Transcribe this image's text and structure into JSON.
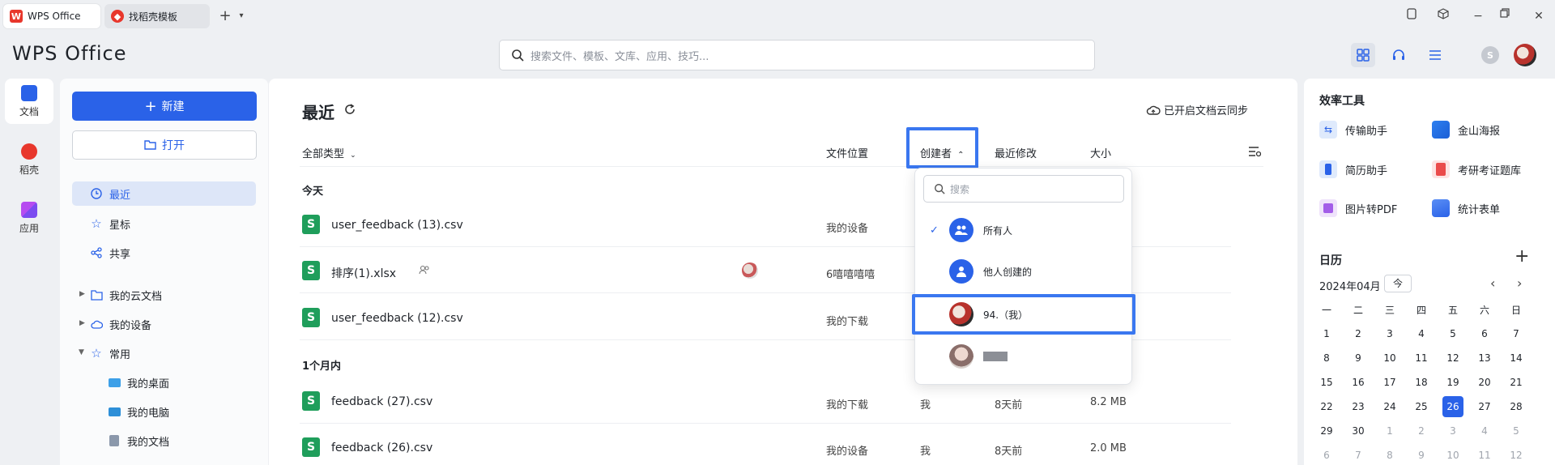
{
  "tabs": [
    {
      "label": "WPS Office"
    },
    {
      "label": "找稻壳模板"
    }
  ],
  "header": {
    "logo": "WPS Office",
    "search_placeholder": "搜索文件、模板、文库、应用、技巧..."
  },
  "rail": [
    {
      "label": "文档"
    },
    {
      "label": "稻壳"
    },
    {
      "label": "应用"
    }
  ],
  "nav": {
    "new_label": "新建",
    "open_label": "打开",
    "items": [
      {
        "label": "最近"
      },
      {
        "label": "星标"
      },
      {
        "label": "共享"
      }
    ],
    "tree": [
      {
        "label": "我的云文档"
      },
      {
        "label": "我的设备"
      },
      {
        "label": "常用"
      }
    ],
    "common": [
      {
        "label": "我的桌面"
      },
      {
        "label": "我的电脑"
      },
      {
        "label": "我的文档"
      }
    ]
  },
  "main": {
    "title": "最近",
    "cloud_sync": "已开启文档云同步",
    "columns": {
      "type_filter": "全部类型",
      "location": "文件位置",
      "creator": "创建者",
      "modified": "最近修改",
      "size": "大小"
    },
    "sections": [
      {
        "label": "今天"
      },
      {
        "label": "1个月内"
      }
    ],
    "files": [
      {
        "name": "user_feedback (13).csv",
        "location": "我的设备",
        "creator": "",
        "modified": "",
        "size": ""
      },
      {
        "name": "排序(1).xlsx",
        "location": "6嘻嘻嘻嘻",
        "creator": "",
        "modified": "",
        "size": ""
      },
      {
        "name": "user_feedback (12).csv",
        "location": "我的下载",
        "creator": "",
        "modified": "",
        "size": ""
      },
      {
        "name": "feedback (27).csv",
        "location": "我的下载",
        "creator": "我",
        "modified": "8天前",
        "size": "8.2 MB"
      },
      {
        "name": "feedback (26).csv",
        "location": "我的设备",
        "creator": "我",
        "modified": "8天前",
        "size": "2.0 MB"
      }
    ],
    "file_icon_letter": "S"
  },
  "dropdown": {
    "search_placeholder": "搜索",
    "options": [
      {
        "label": "所有人",
        "checked": true
      },
      {
        "label": "他人创建的",
        "checked": false
      },
      {
        "label": "94.（我）",
        "checked": false
      },
      {
        "label": "",
        "checked": false
      }
    ]
  },
  "right": {
    "tools_title": "效率工具",
    "tools": [
      {
        "label": "传输助手"
      },
      {
        "label": "金山海报"
      },
      {
        "label": "简历助手"
      },
      {
        "label": "考研考证题库"
      },
      {
        "label": "图片转PDF"
      },
      {
        "label": "统计表单"
      }
    ],
    "calendar": {
      "title": "日历",
      "month": "2024年04月",
      "today_btn": "今",
      "weekdays": [
        "一",
        "二",
        "三",
        "四",
        "五",
        "六",
        "日"
      ],
      "days": [
        "1",
        "2",
        "3",
        "4",
        "5",
        "6",
        "7",
        "8",
        "9",
        "10",
        "11",
        "12",
        "13",
        "14",
        "15",
        "16",
        "17",
        "18",
        "19",
        "20",
        "21",
        "22",
        "23",
        "24",
        "25",
        "26",
        "27",
        "28",
        "29",
        "30",
        "1",
        "2",
        "3",
        "4",
        "5",
        "6",
        "7",
        "8",
        "9",
        "10",
        "11",
        "12"
      ],
      "today": "26"
    }
  },
  "colors": {
    "accent": "#2a62e8",
    "highlight": "#3a77f0",
    "csv_green": "#1f9e5b",
    "wps_red": "#e8372c"
  }
}
